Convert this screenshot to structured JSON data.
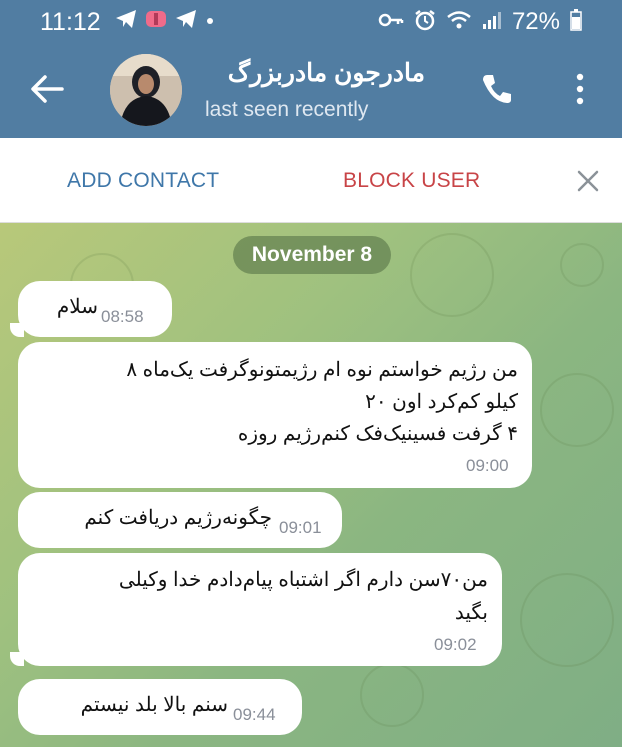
{
  "status_bar": {
    "time": "11:12",
    "battery": "72%",
    "left_icons": [
      "telegram-icon",
      "app-icon",
      "telegram-icon",
      "dot-icon"
    ],
    "right_icons": [
      "key-icon",
      "alarm-icon",
      "wifi-icon",
      "signal-icon",
      "battery-icon"
    ]
  },
  "header": {
    "contact_name": "مادرجون مادربزرگ",
    "status": "last seen recently",
    "icons": [
      "back-arrow-icon",
      "phone-icon",
      "more-vertical-icon"
    ]
  },
  "action_bar": {
    "add_contact": "ADD CONTACT",
    "block_user": "BLOCK USER"
  },
  "chat": {
    "date_label": "November 8",
    "messages": [
      {
        "lines": [
          "سلام"
        ],
        "time": "08:58"
      },
      {
        "lines": [
          "من رژیم خواستم نوه ام رژیمتونوگرفت یک‌ماه ۸",
          "کیلو کم‌کرد اون ۲۰",
          "۴ گرفت فسینیک‌فک کنم‌رژیم روزه"
        ],
        "time": "09:00"
      },
      {
        "lines": [
          "چگونه‌رژیم دریافت کنم"
        ],
        "time": "09:01"
      },
      {
        "lines": [
          "من۷۰سن دارم اگر اشتباه پیام‌دادم خدا وکیلی",
          "بگید"
        ],
        "time": "09:02"
      },
      {
        "lines": [
          "سنم بالا بلد نیستم"
        ],
        "time": "09:44"
      }
    ]
  },
  "colors": {
    "header_bg": "#517da2",
    "add_contact": "#3f77a9",
    "block_user": "#c84447"
  }
}
